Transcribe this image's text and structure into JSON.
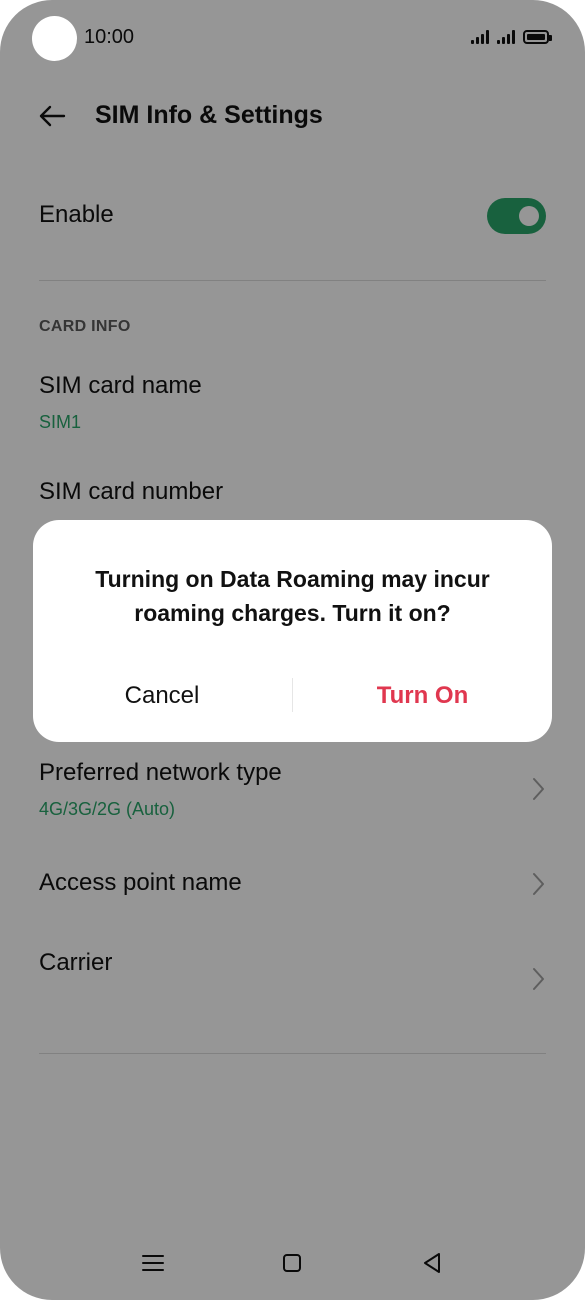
{
  "status_bar": {
    "time": "10:00"
  },
  "header": {
    "title": "SIM Info & Settings"
  },
  "enable": {
    "label": "Enable",
    "state": "on"
  },
  "card_info": {
    "section_label": "CARD INFO",
    "sim_card_name": {
      "title": "SIM card name",
      "value": "SIM1"
    },
    "sim_card_number": {
      "title": "SIM card number"
    }
  },
  "network": {
    "preferred_network_type": {
      "title": "Preferred network type",
      "value": "4G/3G/2G (Auto)"
    },
    "access_point_name": {
      "title": "Access point name"
    },
    "carrier": {
      "title": "Carrier"
    }
  },
  "dialog": {
    "message": "Turning on Data Roaming may incur roaming charges. Turn it on?",
    "cancel_label": "Cancel",
    "confirm_label": "Turn On"
  },
  "colors": {
    "accent": "#2aa66a",
    "confirm": "#e0374f",
    "scrim": "#000000"
  }
}
